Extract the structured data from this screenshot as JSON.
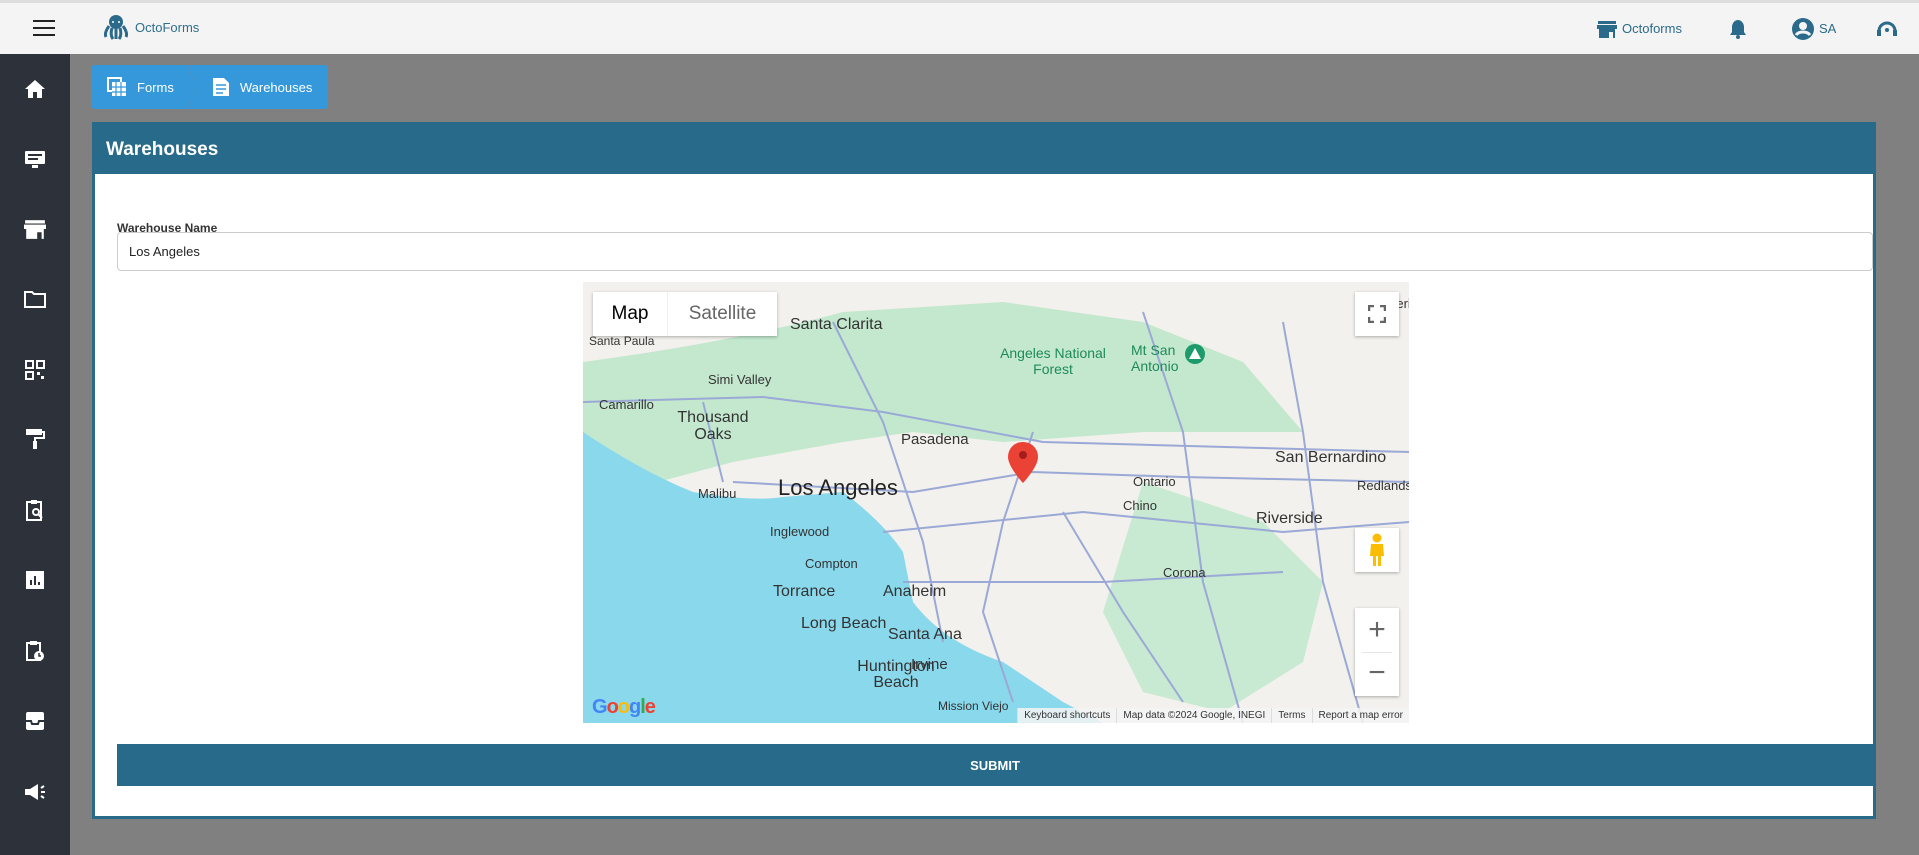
{
  "header": {
    "app_name": "OctoForms",
    "store_label": "Octoforms",
    "user_initials": "SA"
  },
  "sidebar": {
    "items": [
      "home-icon",
      "monitor-icon",
      "store-icon",
      "folder-icon",
      "qr-code-icon",
      "paint-roller-icon",
      "clipboard-search-icon",
      "chart-icon",
      "clipboard-clock-icon",
      "inbox-icon",
      "megaphone-icon"
    ]
  },
  "breadcrumb": [
    {
      "label": "Forms",
      "icon": "forms-grid-icon"
    },
    {
      "label": "Warehouses",
      "icon": "document-icon"
    }
  ],
  "form": {
    "title": "Warehouses",
    "field_label": "Warehouse Name",
    "field_value": "Los Angeles",
    "submit_label": "SUBMIT"
  },
  "map": {
    "type_buttons": [
      "Map",
      "Satellite"
    ],
    "selected_type": "Map",
    "labels": {
      "main": "Los Angeles",
      "cities": [
        "Santa Clarita",
        "Hesperia",
        "Santa Paula",
        "Simi Valley",
        "Camarillo",
        "Thousand Oaks",
        "Angeles National Forest",
        "Mt San Antonio",
        "Pasadena",
        "San Bernardino",
        "Ontario",
        "Redlands",
        "Malibu",
        "Chino",
        "Riverside",
        "Inglewood",
        "Compton",
        "Corona",
        "Torrance",
        "Anaheim",
        "Long Beach",
        "Santa Ana",
        "Huntington Beach",
        "Irvine",
        "Mission Viejo"
      ]
    },
    "attribution": [
      "Keyboard shortcuts",
      "Map data ©2024 Google, INEGI",
      "Terms",
      "Report a map error"
    ],
    "logo": "Google",
    "colors": {
      "water": "#8ad8ec",
      "park": "#b6e6c6",
      "land": "#f2f1ed",
      "road": "#9aa9d6",
      "marker": "#ea4335"
    }
  }
}
